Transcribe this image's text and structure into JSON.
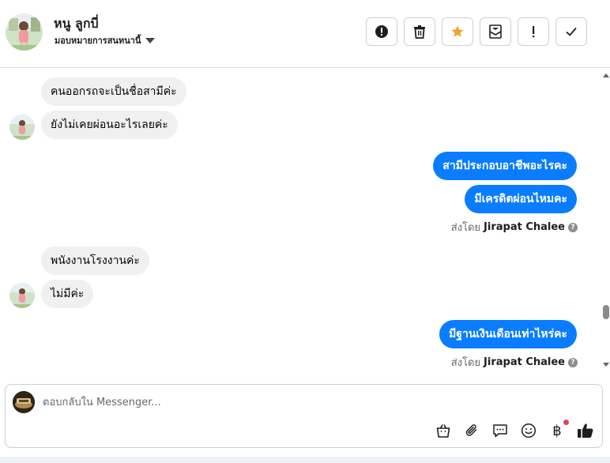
{
  "header": {
    "contact_name": "หนู ลูกบี่",
    "assign_label": "มอบหมายการสนทนานี้",
    "actions": [
      {
        "icon": "alert-circle-icon",
        "glyph": "!"
      },
      {
        "icon": "trash-icon"
      },
      {
        "icon": "star-icon",
        "color": "#f5a12a"
      },
      {
        "icon": "mark-unread-icon"
      },
      {
        "icon": "exclamation-icon",
        "glyph": "!"
      },
      {
        "icon": "check-icon"
      }
    ]
  },
  "messages": [
    {
      "side": "in",
      "text": "คนออกรถจะเป็นชื่อสามีค่ะ"
    },
    {
      "side": "in",
      "text": "ยังไม่เคยผ่อนอะไรเลยค่ะ"
    },
    {
      "side": "out",
      "text": "สามีประกอบอาชีพอะไรคะ"
    },
    {
      "side": "out",
      "text": "มีเครดิตผ่อนไหมคะ"
    },
    {
      "side": "in",
      "text": "พนังงานโรงงานค่ะ"
    },
    {
      "side": "in",
      "text": "ไม่มีค่ะ"
    },
    {
      "side": "out",
      "text": "มีฐานเงินเดือนเท่าไหร่คะ"
    }
  ],
  "sent_by": {
    "prefix": "ส่งโดย",
    "name": "Jirapat Chalee",
    "help_glyph": "?"
  },
  "composer": {
    "placeholder": "ตอบกลับใน Messenger...",
    "tools": [
      "shopping-bag-icon",
      "paperclip-icon",
      "saved-reply-icon",
      "emoji-icon",
      "baht-payment-icon",
      "thumbs-up-icon"
    ],
    "baht_glyph": "฿"
  },
  "colors": {
    "outgoing_bubble": "#0a7cff",
    "incoming_bubble": "#f0f0f0",
    "star": "#f5a12a",
    "notification_dot": "#e8415b"
  }
}
